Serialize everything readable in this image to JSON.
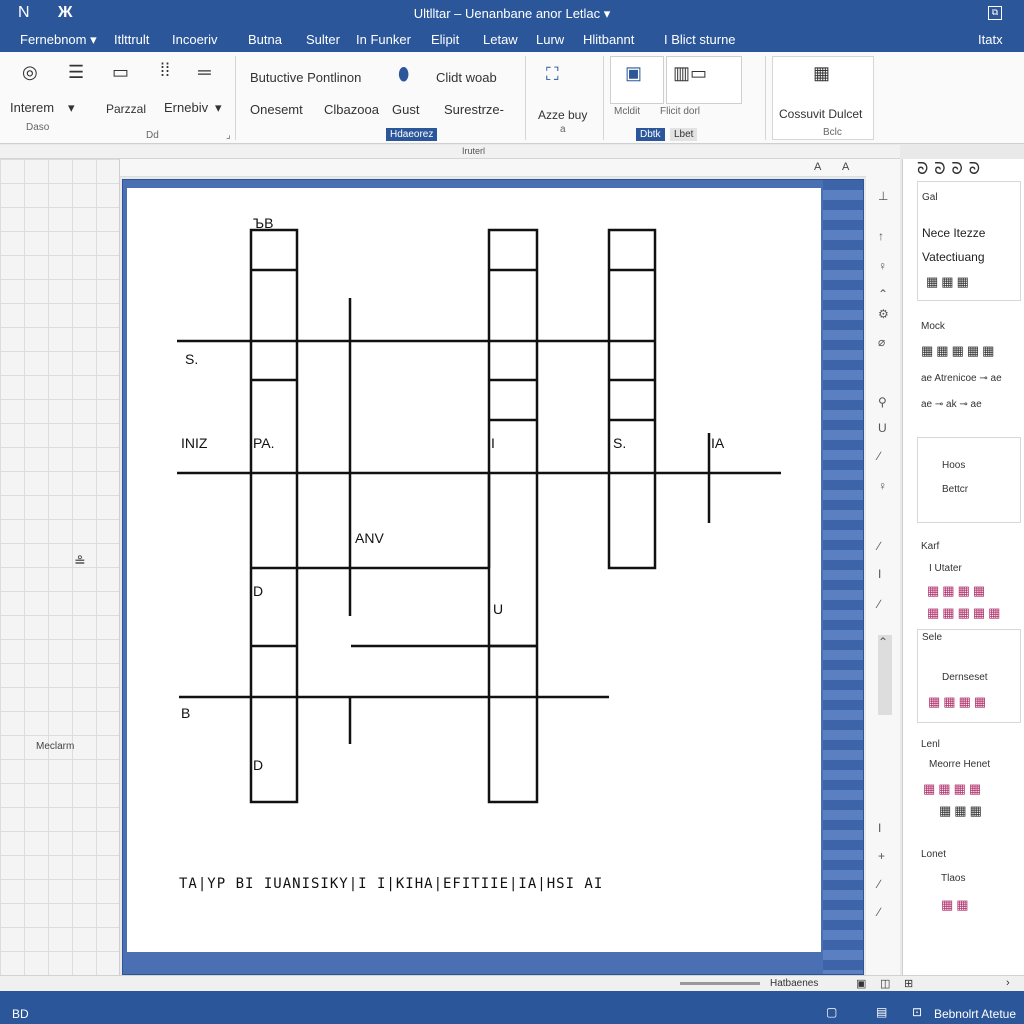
{
  "titlebar": {
    "title": "Ultlltar – Uenanbane anor Letlac ▾",
    "left_icon": "N",
    "logo": "Ж",
    "window_button": "⧉"
  },
  "menu": {
    "items": [
      "Fernebnom ▾",
      "Itlttrult",
      "Incoeriv",
      "Butna",
      "Sulter",
      "In Funker",
      "Elipit",
      "Letaw",
      "Lurw",
      "Hlitbannt",
      "I Blict sturne",
      "Itatx"
    ]
  },
  "ribbon": {
    "g1": {
      "label": "Interem",
      "small": "Daso"
    },
    "g2": {
      "label1": "Parzzal",
      "label2": "Ernebiv",
      "foot": "Dd",
      "foot_icon": "⌟"
    },
    "g3": {
      "label1": "Butuctive Pontlinon",
      "label2": "Onesemt",
      "label3": "Clbazooa",
      "label4": "Clidt woab",
      "label5": "Gust",
      "label6": "Surestrze-",
      "tag": "Hdaeorez"
    },
    "g4": {
      "label": "Azze buy",
      "small": "a"
    },
    "g5": {
      "label1": "Mcldit",
      "label2": "Flicit dorl",
      "tag": "Dbtk",
      "tag2": "Lbet"
    },
    "g6": {
      "label": "Cossuvit Dulcet",
      "small": "Bclc"
    }
  },
  "ruler": {
    "label": "Iruterl"
  },
  "leftpane": {
    "label": "Meclarm"
  },
  "crossword": {
    "clues": [
      "ЪB",
      "S.",
      "INIZ",
      "PA.",
      "I",
      "S.",
      "IA",
      "ANV",
      "D",
      "U",
      "B",
      "D"
    ],
    "strip": "TA|YP BI IUANISIKY|I I|KIHA|EFITIIE|IA|HSI AI"
  },
  "rightpane": {
    "top_icons": "ᘐᘐᘐᘐ",
    "s1": {
      "head": "Gal",
      "line1": "Nece Itezze",
      "line2": "Vatectiuang",
      "tiles": "▦▦▦"
    },
    "s2": {
      "head": "Mock",
      "tiles": "▦▦▦▦▦",
      "row1": "ae Atrenicoe ⊸ ae",
      "row2": "ae ⊸ ak ⊸ ae"
    },
    "s3": {
      "line1": "Hoos",
      "line2": "Bettcr"
    },
    "s4": {
      "head": "Karf",
      "sub": "I Utater",
      "tiles1": "▦▦▦▦",
      "tiles2": "▦▦▦▦▦"
    },
    "s5": {
      "head": "Sele",
      "sub": "Dernseset",
      "tiles": "▦▦▦▦"
    },
    "s6": {
      "head": "Lenl",
      "sub": "Meorre Henet",
      "tiles1": "▦▦▦▦",
      "tiles2": "▦▦▦"
    },
    "s7": {
      "head": "Lonet",
      "sub": "Tlaos",
      "tiles": "▦▦"
    }
  },
  "hscroll": {
    "label": "Hatbaenes"
  },
  "status": {
    "left": "BD",
    "right": "Bebnolrt Atetue"
  }
}
